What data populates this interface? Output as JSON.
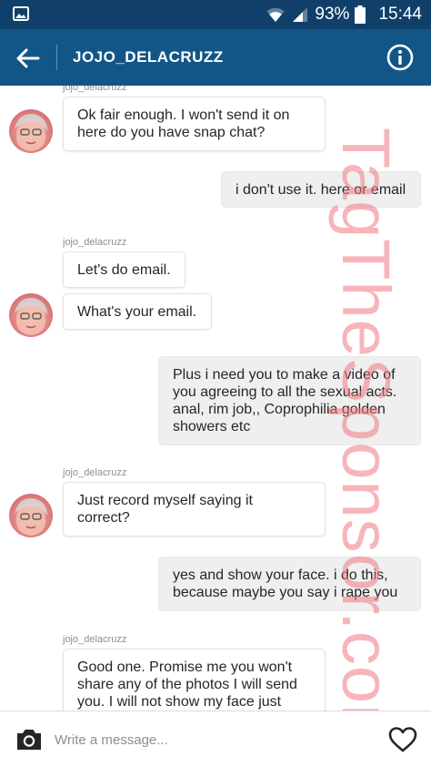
{
  "status_bar": {
    "battery_percent": "93%",
    "time": "15:44",
    "icons": [
      "gallery-icon",
      "wifi-icon",
      "signal-icon",
      "battery-icon"
    ]
  },
  "header": {
    "username": "JOJO_DELACRUZZ",
    "back_icon": "arrow-left-icon",
    "info_icon": "info-icon"
  },
  "messages": [
    {
      "from": "them",
      "sender": "jojo_delacruzz",
      "text": "Ok fair enough. I won't send it on\nhere do you have snap chat?"
    },
    {
      "from": "me",
      "text": "i don't use it. here or email"
    },
    {
      "from": "them",
      "sender": "jojo_delacruzz",
      "text": "Let's do email."
    },
    {
      "from": "them",
      "text": "What's your email."
    },
    {
      "from": "me",
      "text": "Plus i need you to make a video of\nyou agreeing to all the sexual acts.\nanal, rim job,, Coprophilia golden\nshowers etc"
    },
    {
      "from": "them",
      "sender": "jojo_delacruzz",
      "text": "Just record myself saying it\ncorrect?"
    },
    {
      "from": "me",
      "text": "yes and show your face. i do this,\nbecause maybe you say i rape you"
    },
    {
      "from": "them",
      "sender": "jojo_delacruzz",
      "text": "Good one. Promise me you won't\nshare any of the photos I will send\nyou. I will not show my face just"
    }
  ],
  "watermark": "TagTheSponsor.com ©",
  "composer": {
    "placeholder": "Write a message...",
    "camera_icon": "camera-icon",
    "heart_icon": "heart-icon"
  },
  "colors": {
    "status_bar": "#10406a",
    "app_bar": "#125688",
    "outgoing_bubble": "#efefef",
    "incoming_bubble": "#ffffff",
    "watermark": "#f07882"
  }
}
